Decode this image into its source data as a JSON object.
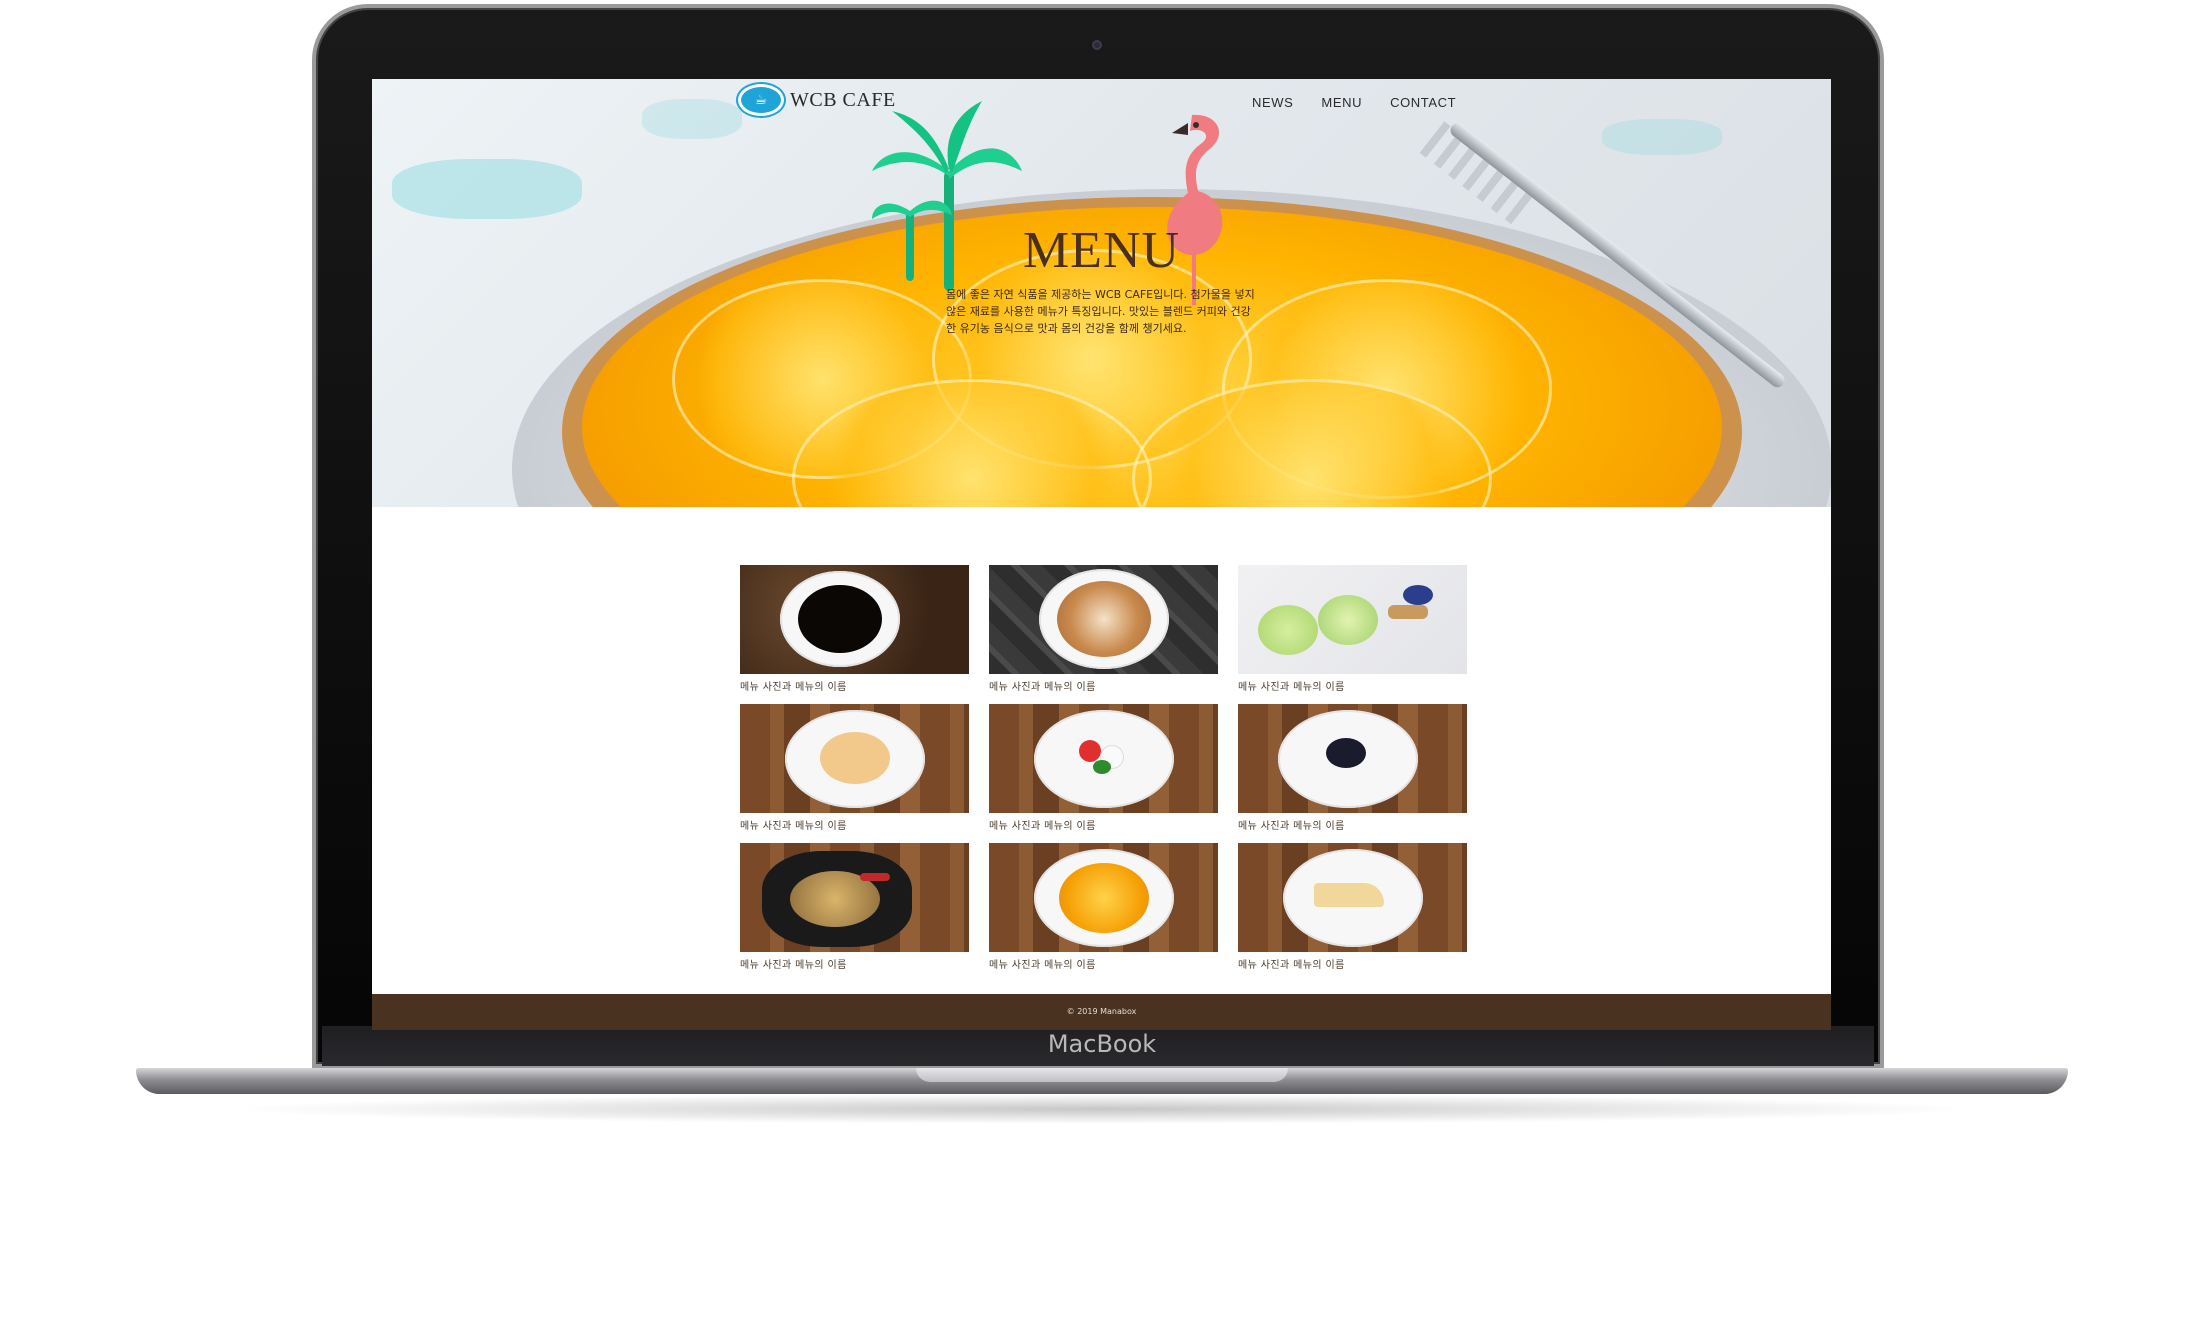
{
  "device": {
    "label": "MacBook"
  },
  "nav": {
    "logo_text": "WCB CAFE",
    "links": [
      "NEWS",
      "MENU",
      "CONTACT"
    ]
  },
  "hero": {
    "title": "MENU",
    "description": "몸에 좋은 자연 식품을 제공하는 WCB CAFE입니다. 첨가물을 넣지 않은 재료를 사용한 메뉴가 특징입니다. 맛있는 블렌드 커피와 건강한 유기농 음식으로 맛과 몸의 건강을 함께 챙기세요."
  },
  "menu_items": [
    {
      "caption": "메뉴 사진과 메뉴의 이름"
    },
    {
      "caption": "메뉴 사진과 메뉴의 이름"
    },
    {
      "caption": "메뉴 사진과 메뉴의 이름"
    },
    {
      "caption": "메뉴 사진과 메뉴의 이름"
    },
    {
      "caption": "메뉴 사진과 메뉴의 이름"
    },
    {
      "caption": "메뉴 사진과 메뉴의 이름"
    },
    {
      "caption": "메뉴 사진과 메뉴의 이름"
    },
    {
      "caption": "메뉴 사진과 메뉴의 이름"
    },
    {
      "caption": "메뉴 사진과 메뉴의 이름"
    }
  ],
  "footer": {
    "copyright": "© 2019 Manabox"
  },
  "colors": {
    "brand_blue": "#1fa4d8",
    "footer_brown": "#4a3220",
    "title_brown": "#4a2f1b"
  }
}
